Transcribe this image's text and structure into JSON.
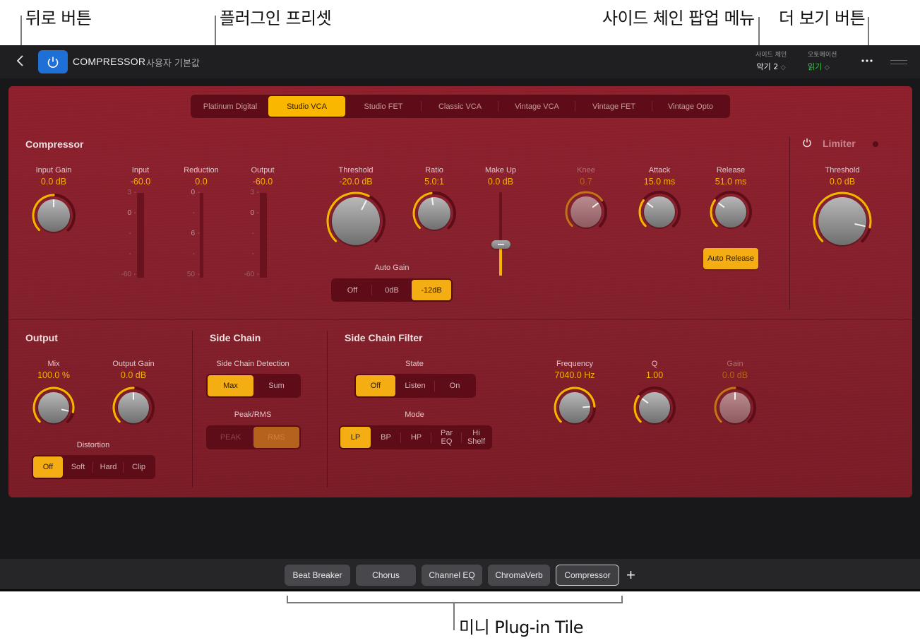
{
  "callouts": {
    "back": "뒤로 버튼",
    "preset": "플러그인 프리셋",
    "sidechain": "사이드 체인 팝업 메뉴",
    "more": "더 보기 버튼",
    "tiles": "미니 Plug-in Tile"
  },
  "topbar": {
    "plugin_name": "COMPRESSOR",
    "preset": "사용자 기본값",
    "sidechain": {
      "label": "사이드 체인",
      "value": "악기 2"
    },
    "automation": {
      "label": "오토메이션",
      "value": "읽기"
    },
    "more_icon": "ellipsis-icon",
    "updown_glyph": "◇"
  },
  "models": {
    "selected": "Studio VCA",
    "items": [
      "Platinum Digital",
      "Studio VCA",
      "Studio FET",
      "Classic VCA",
      "Vintage VCA",
      "Vintage FET",
      "Vintage Opto"
    ]
  },
  "compressor": {
    "title": "Compressor",
    "input_gain": {
      "label": "Input Gain",
      "value": "0.0 dB",
      "position": 0.5
    },
    "meters": {
      "input": {
        "label": "Input",
        "value": "-60.0",
        "ticks": [
          "3",
          "0",
          "-",
          "-",
          "-60"
        ]
      },
      "reduction": {
        "label": "Reduction",
        "value": "0.0",
        "ticks": [
          "0",
          "-",
          "6",
          "-",
          "50"
        ]
      },
      "output": {
        "label": "Output",
        "value": "-60.0",
        "ticks": [
          "3",
          "0",
          "-",
          "-",
          "-60"
        ]
      }
    },
    "threshold": {
      "label": "Threshold",
      "value": "-20.0 dB",
      "position": 0.6
    },
    "ratio": {
      "label": "Ratio",
      "value": "5.0:1",
      "position": 0.47
    },
    "makeup": {
      "label": "Make Up",
      "value": "0.0 dB",
      "position": 0.37
    },
    "knee": {
      "label": "Knee",
      "value": "0.7",
      "position": 0.7
    },
    "attack": {
      "label": "Attack",
      "value": "15.0 ms",
      "position": 0.3
    },
    "release": {
      "label": "Release",
      "value": "51.0 ms",
      "position": 0.3
    },
    "auto_release": "Auto Release",
    "auto_gain": {
      "label": "Auto Gain",
      "options": [
        "Off",
        "0dB",
        "-12dB"
      ],
      "selected": "-12dB"
    }
  },
  "limiter": {
    "title": "Limiter",
    "threshold": {
      "label": "Threshold",
      "value": "0.0 dB",
      "position": 0.88
    }
  },
  "output": {
    "title": "Output",
    "mix": {
      "label": "Mix",
      "value": "100.0 %",
      "position": 0.88
    },
    "output_gain": {
      "label": "Output Gain",
      "value": "0.0 dB",
      "position": 0.5
    },
    "distortion": {
      "label": "Distortion",
      "options": [
        "Off",
        "Soft",
        "Hard",
        "Clip"
      ],
      "selected": "Off"
    }
  },
  "side_chain": {
    "title": "Side Chain",
    "detection": {
      "label": "Side Chain Detection",
      "options": [
        "Max",
        "Sum"
      ],
      "selected": "Max"
    },
    "peak_rms": {
      "label": "Peak/RMS",
      "options": [
        "PEAK",
        "RMS"
      ],
      "selected": "RMS"
    }
  },
  "side_chain_filter": {
    "title": "Side Chain Filter",
    "state": {
      "label": "State",
      "options": [
        "Off",
        "Listen",
        "On"
      ],
      "selected": "Off"
    },
    "mode": {
      "label": "Mode",
      "options": [
        "LP",
        "BP",
        "HP",
        "Par\nEQ",
        "Hi\nShelf"
      ],
      "selected": "LP"
    },
    "frequency": {
      "label": "Frequency",
      "value": "7040.0 Hz",
      "position": 0.82
    },
    "q": {
      "label": "Q",
      "value": "1.00",
      "position": 0.3
    },
    "gain": {
      "label": "Gain",
      "value": "0.0 dB",
      "position": 0.5
    }
  },
  "tiles": {
    "items": [
      "Beat Breaker",
      "Chorus",
      "Channel EQ",
      "ChromaVerb",
      "Compressor"
    ],
    "active": "Compressor",
    "add_label": "+"
  }
}
